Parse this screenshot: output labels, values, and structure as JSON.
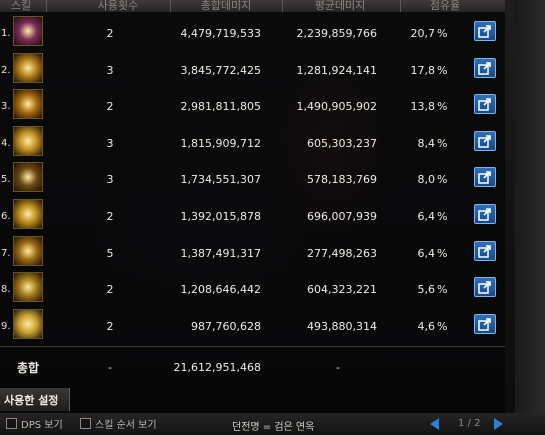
{
  "header": {
    "columns": [
      "스킬",
      "사용횟수",
      "총합데미지",
      "평균데미지",
      "점유율"
    ]
  },
  "rows": [
    {
      "rank": "1.",
      "count": "2",
      "total": "4,479,719,533",
      "avg": "2,239,859,766",
      "pct": "20,7",
      "pct_sign": "%",
      "icon_color": "#7a2a5a"
    },
    {
      "rank": "2.",
      "count": "3",
      "total": "3,845,772,425",
      "avg": "1,281,924,141",
      "pct": "17,8",
      "pct_sign": "%",
      "icon_color": "#b07a18"
    },
    {
      "rank": "3.",
      "count": "2",
      "total": "2,981,811,805",
      "avg": "1,490,905,902",
      "pct": "13,8",
      "pct_sign": "%",
      "icon_color": "#a86a10"
    },
    {
      "rank": "4.",
      "count": "3",
      "total": "1,815,909,712",
      "avg": "605,303,237",
      "pct": "8,4",
      "pct_sign": "%",
      "icon_color": "#c09020"
    },
    {
      "rank": "5.",
      "count": "3",
      "total": "1,734,551,307",
      "avg": "578,183,769",
      "pct": "8,0",
      "pct_sign": "%",
      "icon_color": "#6a4a12"
    },
    {
      "rank": "6.",
      "count": "2",
      "total": "1,392,015,878",
      "avg": "696,007,939",
      "pct": "6,4",
      "pct_sign": "%",
      "icon_color": "#b88a1a"
    },
    {
      "rank": "7.",
      "count": "5",
      "total": "1,387,491,317",
      "avg": "277,498,263",
      "pct": "6,4",
      "pct_sign": "%",
      "icon_color": "#9a6a14"
    },
    {
      "rank": "8.",
      "count": "2",
      "total": "1,208,646,442",
      "avg": "604,323,221",
      "pct": "5,6",
      "pct_sign": "%",
      "icon_color": "#a07818"
    },
    {
      "rank": "9.",
      "count": "2",
      "total": "987,760,628",
      "avg": "493,880,314",
      "pct": "4,6",
      "pct_sign": "%",
      "icon_color": "#c8a030"
    }
  ],
  "total": {
    "label": "총합",
    "count": "-",
    "damage": "21,612,951,468",
    "avg": "-"
  },
  "tabs": {
    "active": "사용한 설정"
  },
  "bottom": {
    "dps_label": "DPS 보기",
    "skill_order_label": "스킬 순서 보기",
    "mode_text": "던전명 = 검은 연옥",
    "page": "1 / 2"
  },
  "colors": {
    "share_button": "#2d6fb8",
    "arrow": "#2f7fd0"
  }
}
